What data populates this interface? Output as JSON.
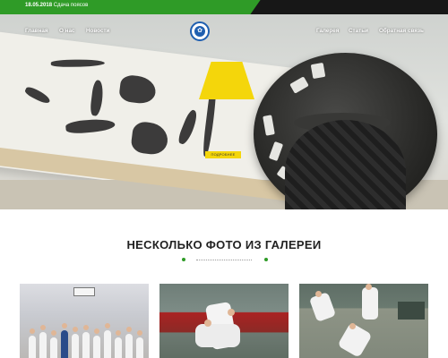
{
  "topbar": {
    "date": "18.05.2018",
    "headline": "Сдача поясов"
  },
  "nav": {
    "left": [
      "Главная",
      "О нас",
      "Новости"
    ],
    "right": [
      "Галерея",
      "Статьи",
      "Обратная связь"
    ]
  },
  "hero": {
    "more_label": "ПОДРОБНЕЕ",
    "slides_count": 3,
    "active_slide": 1
  },
  "gallery": {
    "title": "НЕСКОЛЬКО ФОТО ИЗ ГАЛЕРЕИ"
  },
  "colors": {
    "brand_green": "#2f9b27",
    "accent_yellow": "#f4d60b",
    "logo_blue": "#1f5fb0"
  }
}
